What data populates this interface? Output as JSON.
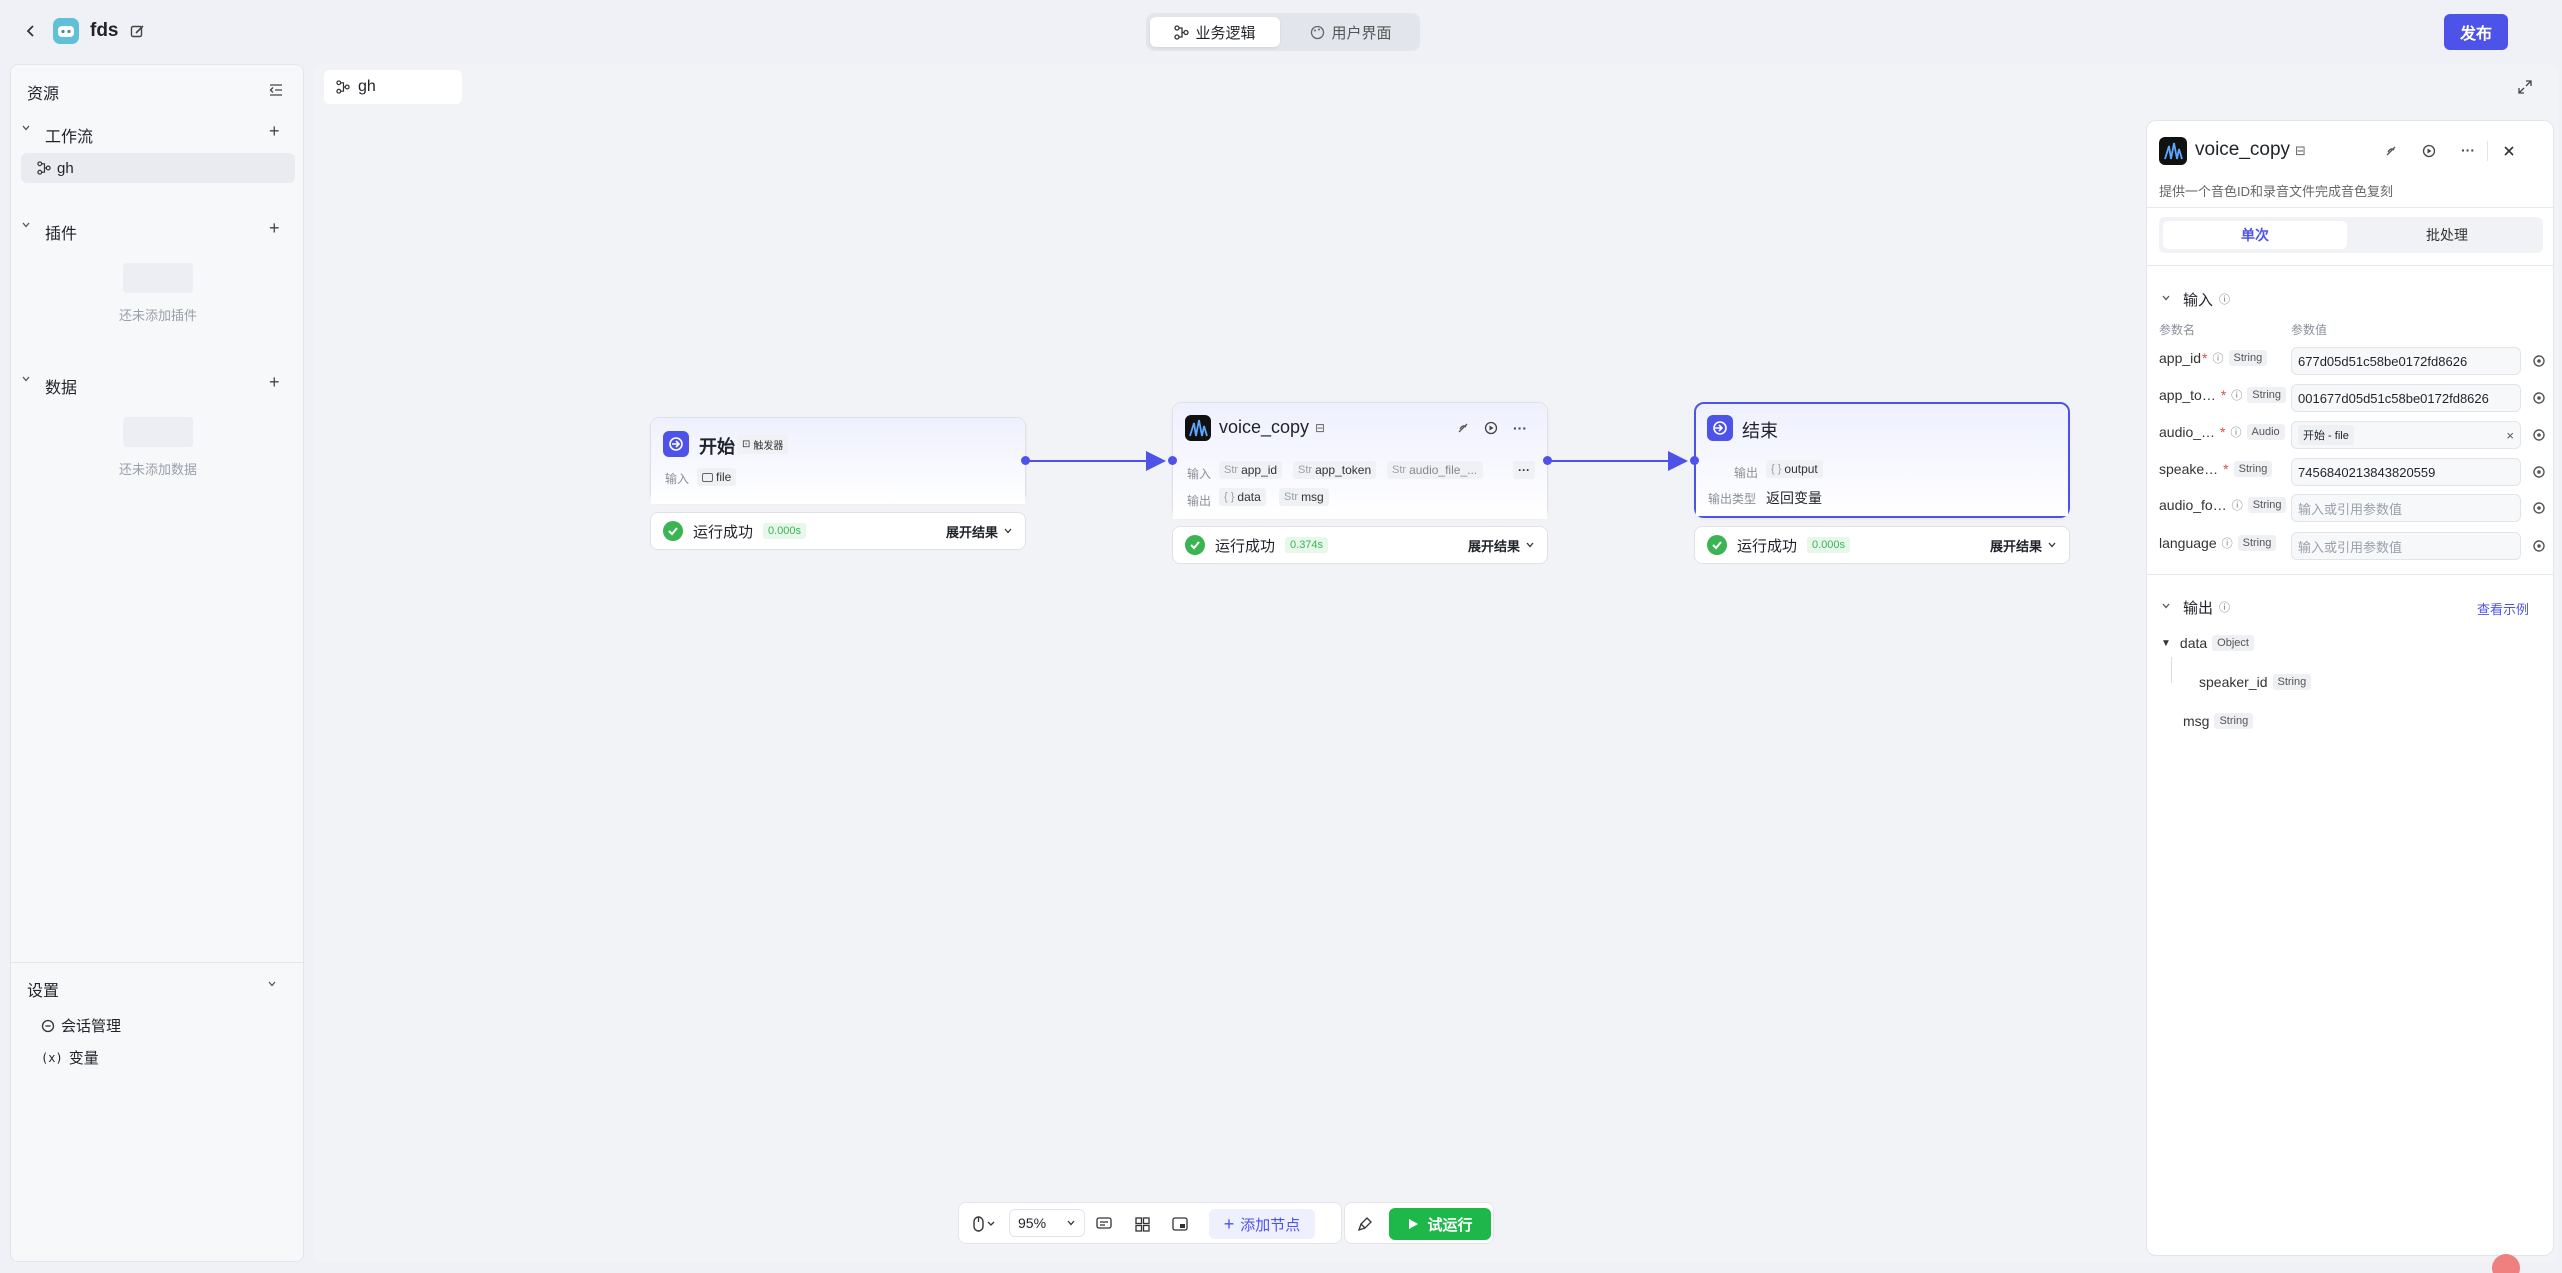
{
  "header": {
    "app_name": "fds",
    "tabs": [
      {
        "label": "业务逻辑",
        "active": true
      },
      {
        "label": "用户界面",
        "active": false
      }
    ],
    "publish_label": "发布",
    "accent": "#4d53e8"
  },
  "sidebar": {
    "title": "资源",
    "workflow": {
      "title": "工作流",
      "items": [
        {
          "label": "gh"
        }
      ]
    },
    "plugins": {
      "title": "插件",
      "empty_text": "还未添加插件"
    },
    "data": {
      "title": "数据",
      "empty_text": "还未添加数据"
    },
    "settings": {
      "title": "设置",
      "items": [
        {
          "label": "会话管理"
        },
        {
          "label": "变量"
        }
      ]
    }
  },
  "canvas": {
    "tab_label": "gh",
    "nodes": {
      "start": {
        "title": "开始",
        "badge": "触发器",
        "input_label": "输入",
        "inputs": [
          "file"
        ],
        "status": "运行成功",
        "duration": "0.000s",
        "expand_label": "展开结果"
      },
      "voice": {
        "title": "voice_copy",
        "input_label": "输入",
        "inputs": [
          {
            "type": "Str",
            "name": "app_id"
          },
          {
            "type": "Str",
            "name": "app_token"
          },
          {
            "type": "Str",
            "name": "audio_file_..."
          }
        ],
        "output_label": "输出",
        "outputs": [
          {
            "type": "{ }",
            "name": "data"
          },
          {
            "type": "Str",
            "name": "msg"
          }
        ],
        "status": "运行成功",
        "duration": "0.374s",
        "expand_label": "展开结果"
      },
      "end": {
        "title": "结束",
        "output_label": "输出",
        "output_var": "output",
        "output_type_label": "输出类型",
        "output_type": "返回变量",
        "status": "运行成功",
        "duration": "0.000s",
        "expand_label": "展开结果"
      }
    }
  },
  "panel": {
    "title": "voice_copy",
    "description": "提供一个音色ID和录音文件完成音色复刻",
    "tabs": [
      {
        "label": "单次",
        "active": true
      },
      {
        "label": "批处理",
        "active": false
      }
    ],
    "input_title": "输入",
    "col_name": "参数名",
    "col_value": "参数值",
    "inputs": [
      {
        "name": "app_id",
        "required": true,
        "type": "String",
        "value": "677d05d51c58be0172fd8626",
        "placeholder": ""
      },
      {
        "name": "app_to…",
        "required": true,
        "type": "String",
        "value": "001677d05d51c58be0172fd8626",
        "placeholder": ""
      },
      {
        "name": "audio_…",
        "required": true,
        "type": "Audio",
        "value": "开始 - file",
        "placeholder": ""
      },
      {
        "name": "speake…",
        "required": true,
        "type": "String",
        "value": "7456840213843820559",
        "placeholder": ""
      },
      {
        "name": "audio_fo…",
        "required": false,
        "type": "String",
        "value": "",
        "placeholder": "输入或引用参数值"
      },
      {
        "name": "language",
        "required": false,
        "type": "String",
        "value": "",
        "placeholder": "输入或引用参数值"
      }
    ],
    "output_title": "输出",
    "view_example": "查看示例",
    "outputs": [
      {
        "name": "data",
        "type": "Object"
      },
      {
        "name": "speaker_id",
        "type": "String"
      },
      {
        "name": "msg",
        "type": "String"
      }
    ]
  },
  "toolbar": {
    "zoom": "95%",
    "add_node": "添加节点",
    "try_run": "试运行",
    "success_color": "#1eb84a"
  }
}
